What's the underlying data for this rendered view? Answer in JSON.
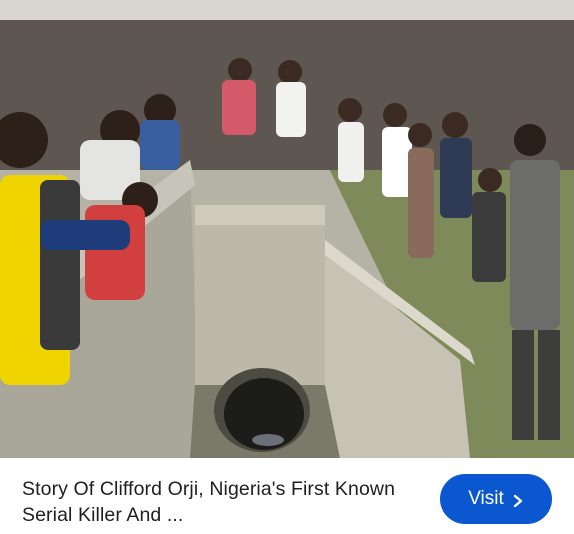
{
  "result_card": {
    "image_icon": "photo-crowd-at-drainage-culvert",
    "headline": "Story Of Clifford Orji, Nigeria's First Known Serial Killer And ...",
    "visit_button": {
      "label": "Visit",
      "icon": "chevron-right-icon"
    }
  },
  "colors": {
    "button_bg": "#0b57d0",
    "button_text": "#ffffff",
    "headline_text": "#1f1f1f"
  }
}
